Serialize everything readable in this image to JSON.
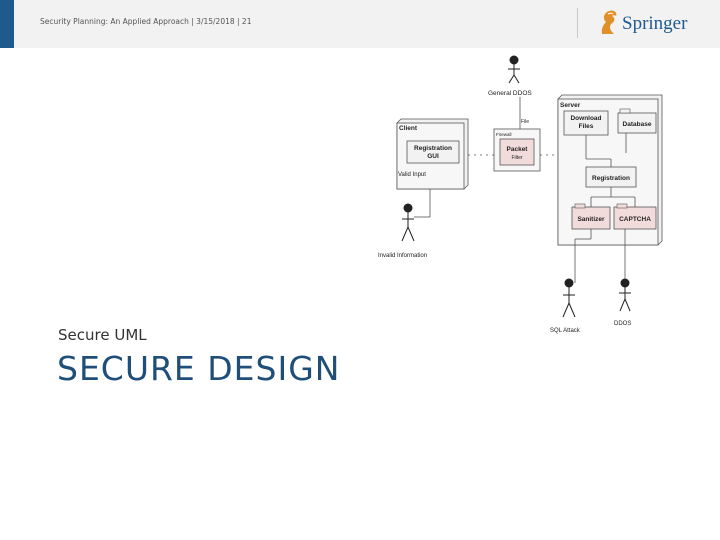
{
  "header": {
    "text": "Security Planning: An Applied Approach | 3/15/2018 | 21",
    "logo_text": "Springer"
  },
  "slide": {
    "subtitle": "Secure UML",
    "title": "SECURE DESIGN"
  },
  "diagram": {
    "actors": {
      "general_ddos": "General DDOS",
      "invalid_information": "Invalid Information",
      "sql_attack": "SQL Attack",
      "ddos": "DDOS"
    },
    "nodes": {
      "client": "Client",
      "registration_gui_line1": "Registration",
      "registration_gui_line2": "GUI",
      "valid_input": "Valid Input",
      "firewall": "Firewall",
      "packet_filter_line1": "Packet",
      "packet_filter_line2": "Filter",
      "server": "Server",
      "download_files_line1": "Download",
      "download_files_line2": "Files",
      "database": "Database",
      "registration": "Registration",
      "sanitizer": "Sanitizer",
      "captcha": "CAPTCHA",
      "file": "File"
    },
    "colors": {
      "highlight": "#f2dcdb",
      "box_bg": "#f2f2f2",
      "line": "#555555"
    }
  }
}
